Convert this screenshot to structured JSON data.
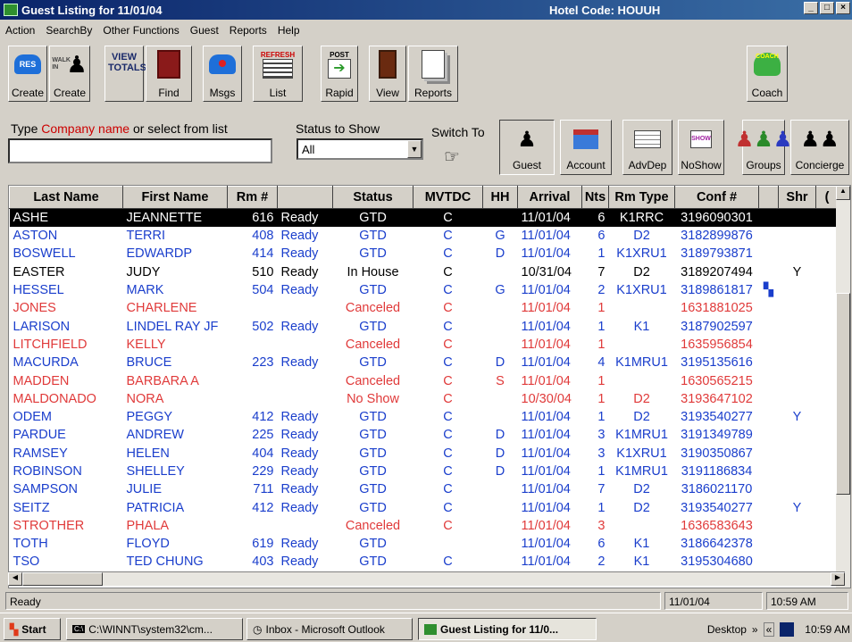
{
  "window": {
    "title": "Guest Listing for 11/01/04",
    "hotel_code": "Hotel Code: HOUUH"
  },
  "menu": [
    "Action",
    "SearchBy",
    "Other Functions",
    "Guest",
    "Reports",
    "Help"
  ],
  "toolbar": {
    "res_create": "Create",
    "res_icon_text": "RES",
    "walkin_create": "Create",
    "walkin_icon_text": "WALK IN",
    "view_totals_text": "VIEW TOTALS",
    "find": "Find",
    "msgs": "Msgs",
    "refresh_text": "REFRESH",
    "list": "List",
    "post_text": "POST",
    "rapid": "Rapid",
    "view": "View",
    "reports": "Reports",
    "coach_icon_text": "COACH",
    "coach": "Coach"
  },
  "filter": {
    "prompt_before": "Type ",
    "prompt_company": "Company name",
    "prompt_after": " or select from list",
    "status_label": "Status to Show",
    "status_value": "All",
    "switch_to": "Switch To"
  },
  "switch_buttons": [
    "Guest",
    "Account",
    "AdvDep",
    "NoShow",
    "Groups",
    "Concierge"
  ],
  "noshow_icon_text": "SHOW",
  "columns": [
    "Last Name",
    "First Name",
    "Rm #",
    "",
    "Status",
    "MVTDC",
    "HH",
    "Arrival",
    "Nts",
    "Rm Type",
    "Conf #",
    "",
    "Shr",
    "("
  ],
  "rows": [
    {
      "last": "ASHE",
      "first": "JEANNETTE",
      "rm": "616",
      "ready": "Ready",
      "status": "GTD",
      "mvtdc": "C",
      "hh": "",
      "arrival": "11/01/04",
      "nts": "6",
      "rmtype": "K1RRC",
      "conf": "3196090301",
      "flag": "",
      "shr": "",
      "color": "sel"
    },
    {
      "last": "ASTON",
      "first": "TERRI",
      "rm": "408",
      "ready": "Ready",
      "status": "GTD",
      "mvtdc": "C",
      "hh": "G",
      "arrival": "11/01/04",
      "nts": "6",
      "rmtype": "D2",
      "conf": "3182899876",
      "flag": "",
      "shr": "",
      "color": "blue"
    },
    {
      "last": "BOSWELL",
      "first": "EDWARDP",
      "rm": "414",
      "ready": "Ready",
      "status": "GTD",
      "mvtdc": "C",
      "hh": "D",
      "arrival": "11/01/04",
      "nts": "1",
      "rmtype": "K1XRU1",
      "conf": "3189793871",
      "flag": "",
      "shr": "",
      "color": "blue"
    },
    {
      "last": "EASTER",
      "first": "JUDY",
      "rm": "510",
      "ready": "Ready",
      "status": "In House",
      "mvtdc": "C",
      "hh": "",
      "arrival": "10/31/04",
      "nts": "7",
      "rmtype": "D2",
      "conf": "3189207494",
      "flag": "",
      "shr": "Y",
      "color": "black"
    },
    {
      "last": "HESSEL",
      "first": "MARK",
      "rm": "504",
      "ready": "Ready",
      "status": "GTD",
      "mvtdc": "C",
      "hh": "G",
      "arrival": "11/01/04",
      "nts": "2",
      "rmtype": "K1XRU1",
      "conf": "3189861817",
      "flag": "▚",
      "shr": "",
      "color": "blue"
    },
    {
      "last": "JONES",
      "first": "CHARLENE",
      "rm": "",
      "ready": "",
      "status": "Canceled",
      "mvtdc": "C",
      "hh": "",
      "arrival": "11/01/04",
      "nts": "1",
      "rmtype": "",
      "conf": "1631881025",
      "flag": "",
      "shr": "",
      "color": "red"
    },
    {
      "last": "LARISON",
      "first": "LINDEL RAY JF",
      "rm": "502",
      "ready": "Ready",
      "status": "GTD",
      "mvtdc": "C",
      "hh": "",
      "arrival": "11/01/04",
      "nts": "1",
      "rmtype": "K1",
      "conf": "3187902597",
      "flag": "",
      "shr": "",
      "color": "blue"
    },
    {
      "last": "LITCHFIELD",
      "first": "KELLY",
      "rm": "",
      "ready": "",
      "status": "Canceled",
      "mvtdc": "C",
      "hh": "",
      "arrival": "11/01/04",
      "nts": "1",
      "rmtype": "",
      "conf": "1635956854",
      "flag": "",
      "shr": "",
      "color": "red"
    },
    {
      "last": "MACURDA",
      "first": "BRUCE",
      "rm": "223",
      "ready": "Ready",
      "status": "GTD",
      "mvtdc": "C",
      "hh": "D",
      "arrival": "11/01/04",
      "nts": "4",
      "rmtype": "K1MRU1",
      "conf": "3195135616",
      "flag": "",
      "shr": "",
      "color": "blue"
    },
    {
      "last": "MADDEN",
      "first": "BARBARA A",
      "rm": "",
      "ready": "",
      "status": "Canceled",
      "mvtdc": "C",
      "hh": "S",
      "arrival": "11/01/04",
      "nts": "1",
      "rmtype": "",
      "conf": "1630565215",
      "flag": "",
      "shr": "",
      "color": "red"
    },
    {
      "last": "MALDONADO",
      "first": "NORA",
      "rm": "",
      "ready": "",
      "status": "No Show",
      "mvtdc": "C",
      "hh": "",
      "arrival": "10/30/04",
      "nts": "1",
      "rmtype": "D2",
      "conf": "3193647102",
      "flag": "",
      "shr": "",
      "color": "red"
    },
    {
      "last": "ODEM",
      "first": "PEGGY",
      "rm": "412",
      "ready": "Ready",
      "status": "GTD",
      "mvtdc": "C",
      "hh": "",
      "arrival": "11/01/04",
      "nts": "1",
      "rmtype": "D2",
      "conf": "3193540277",
      "flag": "",
      "shr": "Y",
      "color": "blue"
    },
    {
      "last": "PARDUE",
      "first": "ANDREW",
      "rm": "225",
      "ready": "Ready",
      "status": "GTD",
      "mvtdc": "C",
      "hh": "D",
      "arrival": "11/01/04",
      "nts": "3",
      "rmtype": "K1MRU1",
      "conf": "3191349789",
      "flag": "",
      "shr": "",
      "color": "blue"
    },
    {
      "last": "RAMSEY",
      "first": "HELEN",
      "rm": "404",
      "ready": "Ready",
      "status": "GTD",
      "mvtdc": "C",
      "hh": "D",
      "arrival": "11/01/04",
      "nts": "3",
      "rmtype": "K1XRU1",
      "conf": "3190350867",
      "flag": "",
      "shr": "",
      "color": "blue"
    },
    {
      "last": "ROBINSON",
      "first": "SHELLEY",
      "rm": "229",
      "ready": "Ready",
      "status": "GTD",
      "mvtdc": "C",
      "hh": "D",
      "arrival": "11/01/04",
      "nts": "1",
      "rmtype": "K1MRU1",
      "conf": "3191186834",
      "flag": "",
      "shr": "",
      "color": "blue"
    },
    {
      "last": "SAMPSON",
      "first": "JULIE",
      "rm": "711",
      "ready": "Ready",
      "status": "GTD",
      "mvtdc": "C",
      "hh": "",
      "arrival": "11/01/04",
      "nts": "7",
      "rmtype": "D2",
      "conf": "3186021170",
      "flag": "",
      "shr": "",
      "color": "blue"
    },
    {
      "last": "SEITZ",
      "first": "PATRICIA",
      "rm": "412",
      "ready": "Ready",
      "status": "GTD",
      "mvtdc": "C",
      "hh": "",
      "arrival": "11/01/04",
      "nts": "1",
      "rmtype": "D2",
      "conf": "3193540277",
      "flag": "",
      "shr": "Y",
      "color": "blue"
    },
    {
      "last": "STROTHER",
      "first": "PHALA",
      "rm": "",
      "ready": "",
      "status": "Canceled",
      "mvtdc": "C",
      "hh": "",
      "arrival": "11/01/04",
      "nts": "3",
      "rmtype": "",
      "conf": "1636583643",
      "flag": "",
      "shr": "",
      "color": "red"
    },
    {
      "last": "TOTH",
      "first": "FLOYD",
      "rm": "619",
      "ready": "Ready",
      "status": "GTD",
      "mvtdc": "",
      "hh": "",
      "arrival": "11/01/04",
      "nts": "6",
      "rmtype": "K1",
      "conf": "3186642378",
      "flag": "",
      "shr": "",
      "color": "blue"
    },
    {
      "last": "TSO",
      "first": "TED CHUNG",
      "rm": "403",
      "ready": "Ready",
      "status": "GTD",
      "mvtdc": "C",
      "hh": "",
      "arrival": "11/01/04",
      "nts": "2",
      "rmtype": "K1",
      "conf": "3195304680",
      "flag": "",
      "shr": "",
      "color": "blue"
    }
  ],
  "statusbar": {
    "text": "Ready",
    "date": "11/01/04",
    "time": "10:59 AM"
  },
  "taskbar": {
    "start": "Start",
    "tasks": [
      "C:\\WINNT\\system32\\cm...",
      "Inbox - Microsoft Outlook",
      "Guest Listing for 11/0..."
    ],
    "desktop": "Desktop",
    "clock": "10:59 AM"
  },
  "colors": {
    "title_bar": "#0a246a",
    "blue_text": "#1a3ecc",
    "red_text": "#e03a3a",
    "selected_row": "#000000"
  }
}
